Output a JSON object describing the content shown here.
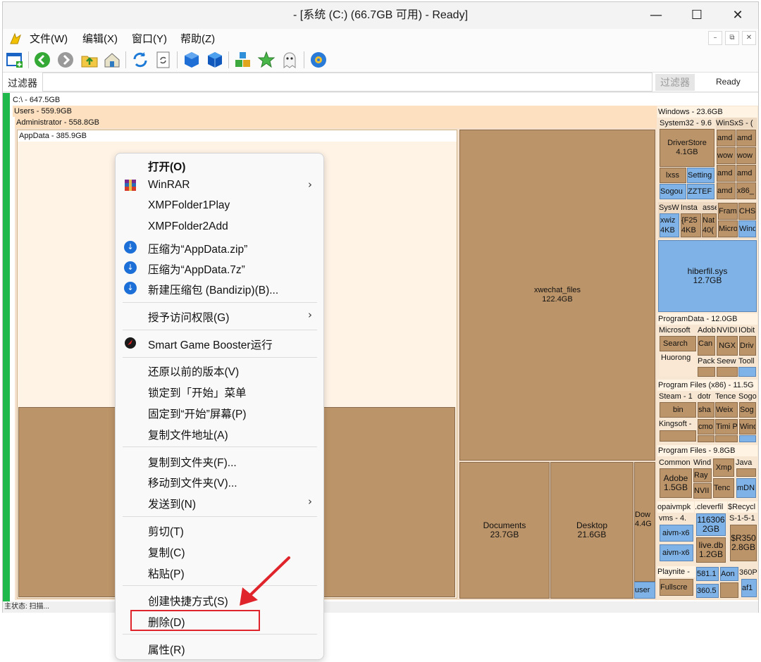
{
  "window": {
    "title": "- [系统 (C:) (66.7GB 可用) - Ready]",
    "minimize": "—",
    "maximize": "☐",
    "close": "✕"
  },
  "menu": {
    "items": [
      "文件(W)",
      "编辑(X)",
      "窗口(Y)",
      "帮助(Z)"
    ],
    "mdi_min": "–",
    "mdi_restore": "⧉",
    "mdi_close": "✕"
  },
  "filter": {
    "label": "过滤器",
    "label2": "过滤器",
    "status": "Ready"
  },
  "treemap": {
    "root": "C:\\ - 647.5GB",
    "users": "Users - 559.9GB",
    "administrator": "Administrator - 558.8GB",
    "appdata": "AppData - 385.9GB",
    "xwechat": "xwechat_files",
    "xwechat_size": "122.4GB",
    "documents": "Documents",
    "documents_size": "23.7GB",
    "desktop": "Desktop",
    "desktop_size": "21.6GB",
    "downloads": "Dow",
    "downloads_size": "4.4G",
    "user_small": "user",
    "windows": "Windows - 23.6GB",
    "system32": "System32 - 9.6",
    "winsxs": "WinSxS - (",
    "driverstore": "DriverStore",
    "driverstore_size": "4.1GB",
    "lxss": "lxss",
    "setting": "Setting",
    "sogou": "Sogou",
    "zztef": "ZZTEF",
    "amd1": "amd",
    "amd2": "amd",
    "wow1": "wow",
    "wow2": "wow",
    "amd3": "amd",
    "amd4": "amd",
    "amd5": "amd",
    "x86": "x86_",
    "sysw": "SysW",
    "insta": "Insta",
    "asse": "asse",
    "fram": "Fram",
    "chs": "CHS",
    "xwiz": "xwiz",
    "xwiz_size": "4KB",
    "f25": "{F25",
    "f25_size": "4KB",
    "nat": "Nat",
    "nat_size": "40(",
    "micro": "Micro",
    "winb": "Wind",
    "hiberfil": "hiberfil.sys",
    "hiberfil_size": "12.7GB",
    "programdata": "ProgramData - 12.0GB",
    "pd_microsoft": "Microsoft",
    "pd_adob": "Adob",
    "pd_nvidi": "NVIDI",
    "pd_iobi": "IObit",
    "pd_search": "Search",
    "pd_can": "Can",
    "pd_ngx": "NGX",
    "pd_dri": "Driv",
    "pd_huorong": "Huorong",
    "pd_pack": "Pack",
    "pd_seew": "Seew",
    "pd_tool": "Tooll",
    "pf86": "Program Files (x86) - 11.5G",
    "pf86_steam": "Steam - 1",
    "pf86_dot": "dotr",
    "pf86_tence": "Tence",
    "pf86_sogo": "Sogo",
    "pf86_bin": "bin",
    "pf86_sha": "sha",
    "pf86_weix": "Weix",
    "pf86_sog": "Sog",
    "pf86_kingsoft": "Kingsoft -",
    "pf86_cmd": "cmo",
    "pf86_timi": "Timi P",
    "pf86_wind": "Wind",
    "pf": "Program Files - 9.8GB",
    "pf_common": "Common",
    "pf_wind": "Wind",
    "pf_xmp": "Xmp",
    "pf_java": "Java",
    "pf_ray": "Ray",
    "pf_adobe": "Adobe",
    "pf_adobe_size": "1.5GB",
    "pf_nvi": "NVII",
    "pf_tenc": "Tenc",
    "pf_mdn": "mDN",
    "opai": "opaivmpk",
    "clever": ".cleverfil",
    "recycle": "$Recycl",
    "vms": "vms - 4.",
    "num116": "116306",
    "num116_size": "2GB",
    "s15": "S-1-5-1",
    "aivm1": "aivm-x6",
    "aivm2": "aivm-x6",
    "livedb": "live.db",
    "livedb_size": "1.2GB",
    "r350": "$R350",
    "r350_size": "2.8GB",
    "playnite": "Playnite -",
    "num581": "581.1",
    "aon": "Aon",
    "p360": "360P",
    "fullscre": "Fullscre",
    "num360": "360.5",
    "af1": "af1"
  },
  "context_menu": {
    "open": "打开(O)",
    "winrar": "WinRAR",
    "xmp1": "XMPFolder1Play",
    "xmp2": "XMPFolder2Add",
    "zip": "压缩为“AppData.zip”",
    "sevenz": "压缩为“AppData.7z”",
    "bandizip": "新建压缩包 (Bandizip)(B)...",
    "grant": "授予访问权限(G)",
    "sgb": "Smart Game Booster运行",
    "restore": "还原以前的版本(V)",
    "pin_start_menu": "锁定到「开始」菜单",
    "pin_start_screen": "固定到“开始”屏幕(P)",
    "copy_path": "复制文件地址(A)",
    "copy_to": "复制到文件夹(F)...",
    "move_to": "移动到文件夹(V)...",
    "send_to": "发送到(N)",
    "cut": "剪切(T)",
    "copy": "复制(C)",
    "paste": "粘贴(P)",
    "shortcut": "创建快捷方式(S)",
    "delete": "删除(D)",
    "properties": "属性(R)",
    "arrow": "›"
  },
  "status": {
    "text": "主状态: 扫描..."
  },
  "colors": {
    "accent_annotation": "#e0242b",
    "treemap_block": "#bc9469",
    "treemap_header": "#fde0c0",
    "treemap_file": "#7fb2e6"
  }
}
